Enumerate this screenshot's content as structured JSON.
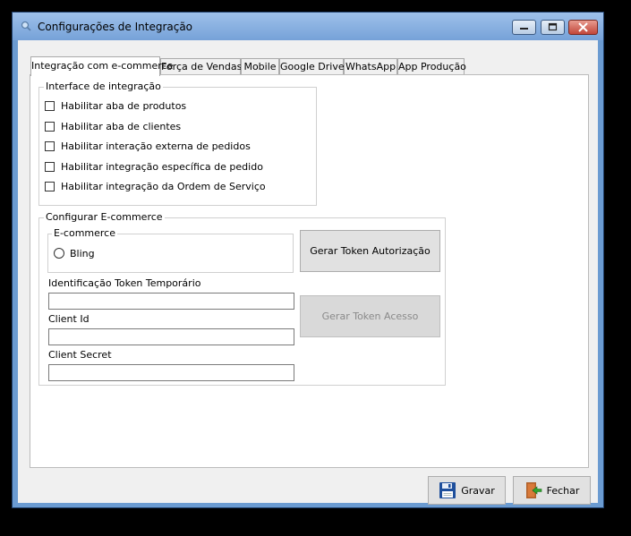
{
  "window": {
    "title": "Configurações de Integração"
  },
  "tabs": [
    {
      "label": "Integração com e-commerce",
      "active": true
    },
    {
      "label": "Força de Vendas"
    },
    {
      "label": "Mobile"
    },
    {
      "label": "Google Drive"
    },
    {
      "label": "WhatsApp"
    },
    {
      "label": "App Produção"
    }
  ],
  "interface_group": {
    "legend": "Interface de integração",
    "options": [
      {
        "label": "Habilitar aba de produtos",
        "checked": false
      },
      {
        "label": "Habilitar aba de clientes",
        "checked": false
      },
      {
        "label": "Habilitar interação externa de pedidos",
        "checked": false
      },
      {
        "label": "Habilitar integração específica de pedido",
        "checked": false
      },
      {
        "label": "Habilitar integração da Ordem de Serviço",
        "checked": false
      }
    ]
  },
  "ecommerce_group": {
    "legend": "Configurar E-commerce",
    "inner_legend": "E-commerce",
    "radio_label": "Bling",
    "token_label": "Identificação Token Temporário",
    "token_value": "",
    "client_id_label": "Client Id",
    "client_id_value": "",
    "client_secret_label": "Client Secret",
    "client_secret_value": "",
    "auth_button": "Gerar Token Autorização",
    "access_button": "Gerar Token Acesso"
  },
  "footer": {
    "save_label": "Gravar",
    "close_label": "Fechar"
  },
  "colors": {
    "title_bar": "#76a2d8",
    "close_button": "#c2473a",
    "background": "#f0f0f0"
  }
}
